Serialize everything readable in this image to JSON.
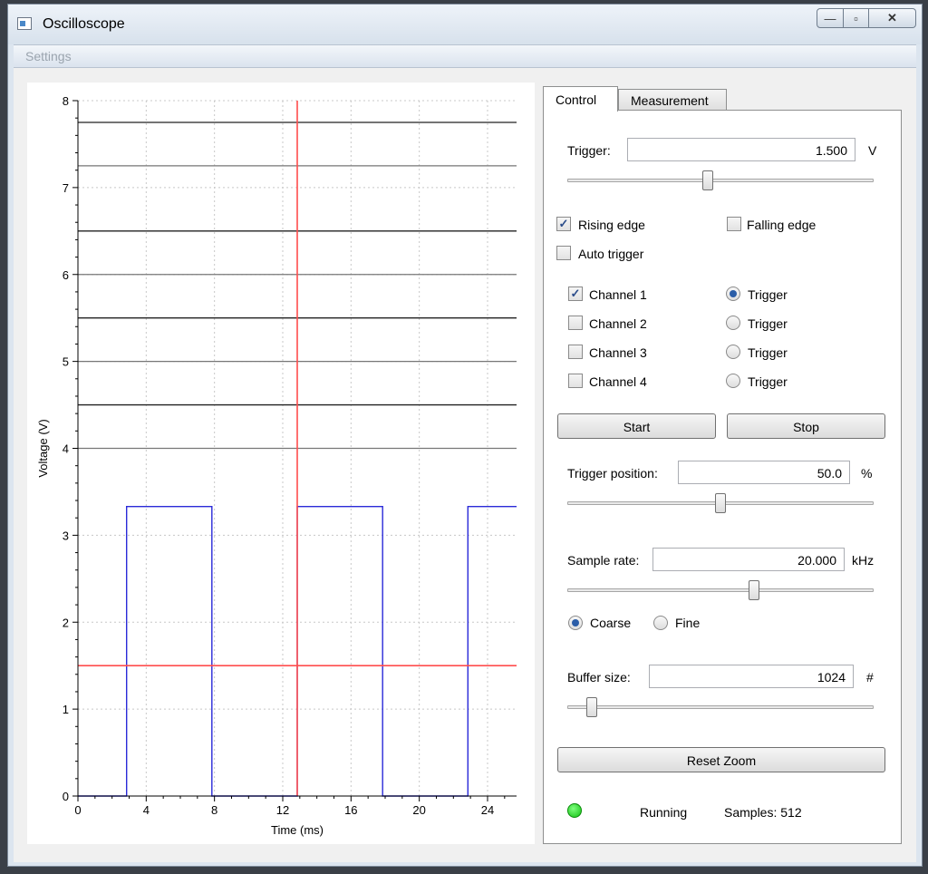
{
  "window": {
    "title": "Oscilloscope",
    "min_glyph": "—",
    "max_glyph": "▫",
    "close_glyph": "✕"
  },
  "menu": {
    "settings": "Settings"
  },
  "colors": {
    "trace": "#2a2ad8",
    "cursor": "#ff4d4d",
    "levels": "#222222",
    "status_led": "#22cc22"
  },
  "chart_data": {
    "type": "line",
    "xlabel": "Time (ms)",
    "ylabel": "Voltage (V)",
    "xlim": [
      0,
      25.7
    ],
    "ylim": [
      0,
      8
    ],
    "xticks": [
      0,
      4,
      8,
      12,
      16,
      20,
      24
    ],
    "yticks": [
      0,
      1,
      2,
      3,
      4,
      5,
      6,
      7,
      8
    ],
    "grid": true,
    "series": [
      {
        "x": [
          0,
          2.85,
          2.85,
          7.85,
          7.85,
          12.85,
          12.85,
          17.85,
          17.85,
          22.85,
          22.85,
          25.7
        ],
        "y": [
          0,
          0,
          3.33,
          3.33,
          0,
          0,
          3.33,
          3.33,
          0,
          0,
          3.33,
          3.33
        ]
      }
    ],
    "reference_lines": [
      7.75,
      7.25,
      6.5,
      6.0,
      5.5,
      5.0,
      4.5,
      4.0
    ],
    "trigger_level": 1.5,
    "trigger_time": 12.85
  },
  "tabs": {
    "control": "Control",
    "measurement": "Measurement"
  },
  "control": {
    "trigger_label": "Trigger:",
    "trigger_value": "1.500",
    "trigger_unit": "V",
    "trigger_slider": 0.46,
    "rising_edge": "Rising edge",
    "falling_edge": "Falling edge",
    "auto_trigger": "Auto trigger",
    "channels": [
      {
        "label": "Channel 1",
        "trigger": "Trigger"
      },
      {
        "label": "Channel 2",
        "trigger": "Trigger"
      },
      {
        "label": "Channel 3",
        "trigger": "Trigger"
      },
      {
        "label": "Channel 4",
        "trigger": "Trigger"
      }
    ],
    "start": "Start",
    "stop": "Stop",
    "trigger_position_label": "Trigger position:",
    "trigger_position_value": "50.0",
    "trigger_position_unit": "%",
    "trigger_position_slider": 0.5,
    "sample_rate_label": "Sample rate:",
    "sample_rate_value": "20.000",
    "sample_rate_unit": "kHz",
    "sample_rate_slider": 0.61,
    "coarse": "Coarse",
    "fine": "Fine",
    "buffer_size_label": "Buffer size:",
    "buffer_size_value": "1024",
    "buffer_size_unit": "#",
    "buffer_size_slider": 0.08,
    "reset_zoom": "Reset Zoom",
    "status": "Running",
    "samples": "Samples: 512"
  }
}
